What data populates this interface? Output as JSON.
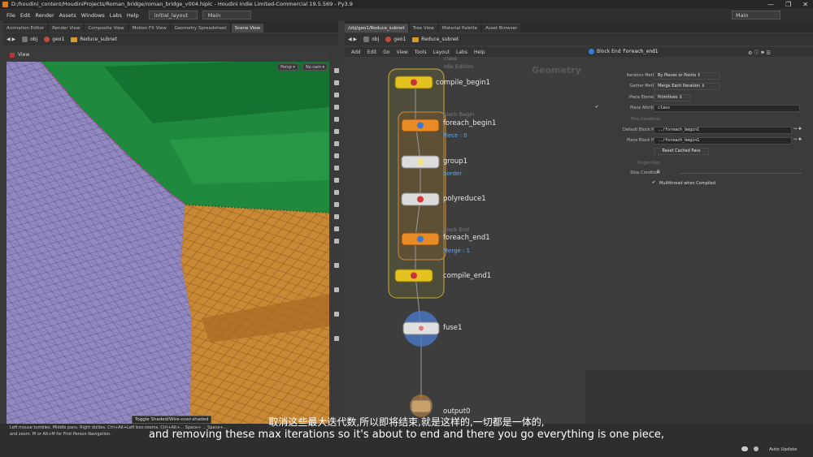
{
  "window": {
    "title": "D:/houdini_content/HoudiniProjects/Roman_bridge/roman_bridge_v004.hiplc - Houdini Indie Limited-Commercial 19.5.569 - Py3.9",
    "controls": [
      "—",
      "❐",
      "✕"
    ]
  },
  "menu": {
    "items": [
      "File",
      "Edit",
      "Render",
      "Assets",
      "Windows",
      "Labs",
      "Help"
    ],
    "desktop": "initial_layout",
    "main_desk": "Main",
    "right_desk": "Main"
  },
  "left_tabs": [
    "Animation Editor",
    "Render View",
    "Composite View",
    "Motion FX View",
    "Geometry Spreadsheet",
    "Scene View"
  ],
  "right_tabs": [
    "/obj/geo1/Reduce_subnet",
    "Tree View",
    "Material Palette",
    "Asset Browser"
  ],
  "left_path": {
    "obj": "obj",
    "geo": "geo1",
    "subnet": "Reduce_subnet"
  },
  "right_path": {
    "obj": "obj",
    "geo": "geo1",
    "subnet": "Reduce_subnet"
  },
  "viewport": {
    "header_label": "View",
    "persp_label": "Persp ▾",
    "cam_label": "No cam ▾",
    "tooltip": "Toggle Shaded/Wire-over-shaded"
  },
  "network": {
    "menu": [
      "Add",
      "Edit",
      "Go",
      "View",
      "Tools",
      "Layout",
      "Labs",
      "Help"
    ],
    "watermark": "Geometry",
    "nodes": [
      {
        "name": "compile_begin1",
        "header": "class",
        "header2": "Idle Edition",
        "sub": ""
      },
      {
        "name": "foreach_begin1",
        "header": "Block Begin",
        "sub": "Piece : 0"
      },
      {
        "name": "group1",
        "header": "",
        "sub": "border"
      },
      {
        "name": "polyreduce1",
        "header": "",
        "sub": ""
      },
      {
        "name": "foreach_end1",
        "header": "Block End",
        "sub": "Merge : 1"
      },
      {
        "name": "compile_end1",
        "header": "",
        "sub": ""
      },
      {
        "name": "fuse1",
        "header": "",
        "sub": ""
      },
      {
        "name": "output0",
        "header": "",
        "sub": ""
      }
    ]
  },
  "params": {
    "node_type": "Block End",
    "node_name": "foreach_end1",
    "rows": [
      {
        "label": "Iteration Method",
        "value": "By Pieces or Points ⇕"
      },
      {
        "label": "Gather Method",
        "value": "Merge Each Iteration ⇕"
      },
      {
        "label": "Piece Elements",
        "value": "Primitives ⇕"
      },
      {
        "label": "Piece Attribute",
        "value": "class"
      },
      {
        "label": "Max Iterations",
        "value": ""
      },
      {
        "label": "Default Block Path",
        "value": "../foreach_begin1"
      },
      {
        "label": "Piece Block Path",
        "value": "../foreach_begin1"
      },
      {
        "label": "",
        "value": "Reset Cached Pass"
      },
      {
        "label": "Single Pass",
        "value": ""
      },
      {
        "label": "Stop Condition",
        "value": "0"
      }
    ],
    "multithread": "Multithread when Compiled"
  },
  "status": {
    "hint_line1": "Left mouse tumbles. Middle pans. Right dollies. Ctrl+Alt+Left box-zooms. Ctrl+Alt+... Space+ ... Space+...",
    "hint_line2": "and zoom.    M or Alt+M for First Person Navigation.",
    "auto_update": "Auto Update"
  },
  "subtitles": {
    "cn": "取消这些最大迭代数,所以即将结束,就是这样的,一切都是一体的,",
    "en": "and removing these max iterations so it's about to end and there you go everything is one piece,"
  }
}
